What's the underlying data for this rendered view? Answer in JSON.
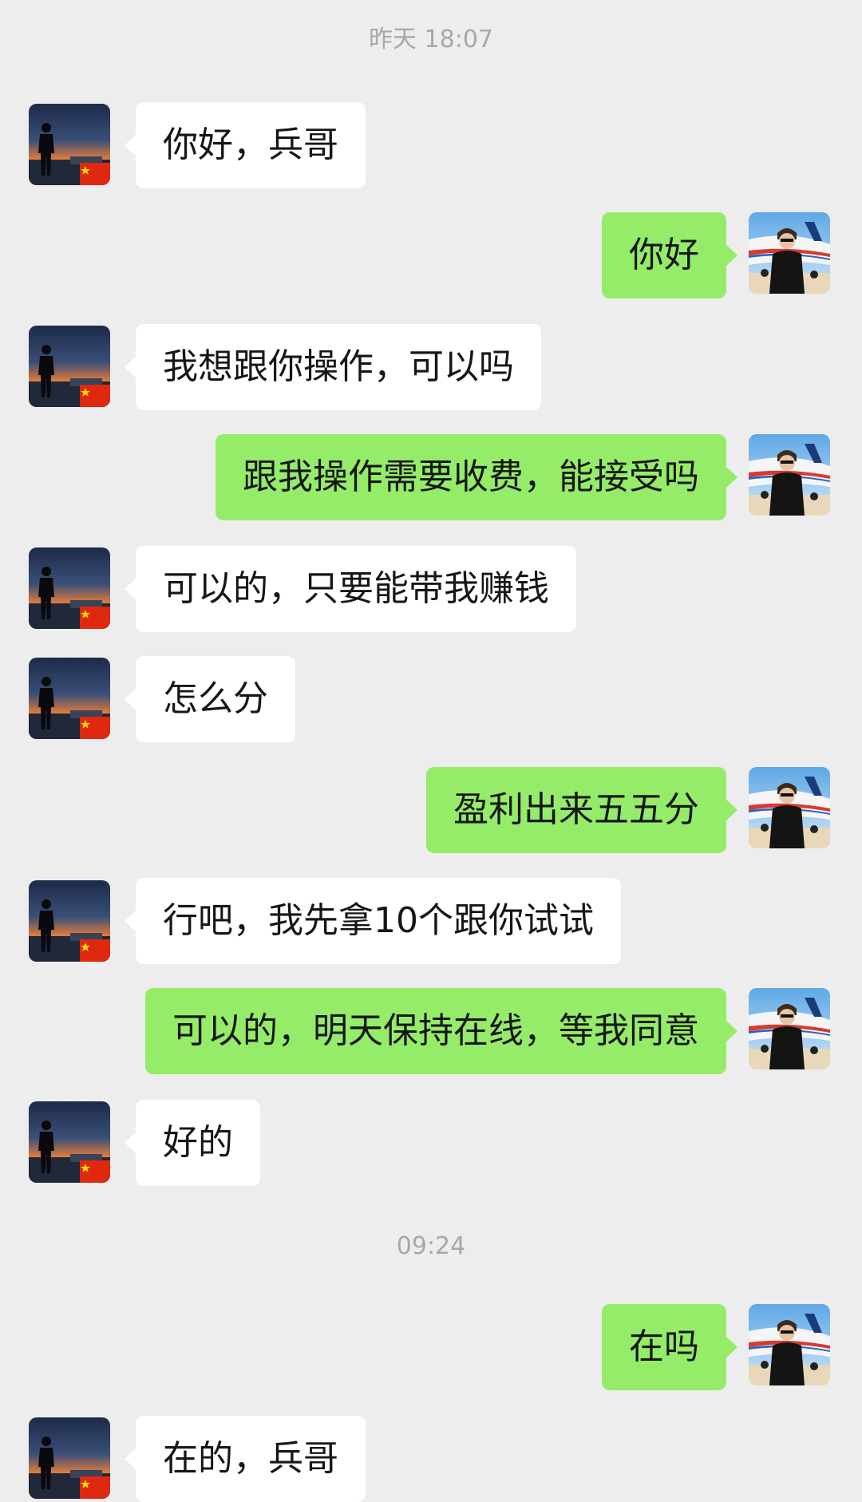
{
  "timestamps": {
    "first": "昨天 18:07",
    "second": "09:24"
  },
  "contact_avatar_icon": "silhouette-sunset-avatar-with-china-flag",
  "self_avatar_icon": "man-with-airplane-avatar",
  "colors": {
    "background": "#ededed",
    "incoming_bubble": "#ffffff",
    "outgoing_bubble": "#95ec69",
    "timestamp_text": "#a8a8a8"
  },
  "messages": [
    {
      "side": "in",
      "text": "你好，兵哥"
    },
    {
      "side": "out",
      "text": "你好"
    },
    {
      "side": "in",
      "text": "我想跟你操作，可以吗"
    },
    {
      "side": "out",
      "text": "跟我操作需要收费，能接受吗"
    },
    {
      "side": "in",
      "text": "可以的，只要能带我赚钱"
    },
    {
      "side": "in",
      "text": "怎么分"
    },
    {
      "side": "out",
      "text": "盈利出来五五分"
    },
    {
      "side": "in",
      "text": "行吧，我先拿10个跟你试试"
    },
    {
      "side": "out",
      "text": "可以的，明天保持在线，等我同意"
    },
    {
      "side": "in",
      "text": "好的"
    },
    {
      "side": "out",
      "text": "在吗"
    },
    {
      "side": "in",
      "text": "在的，兵哥"
    }
  ]
}
